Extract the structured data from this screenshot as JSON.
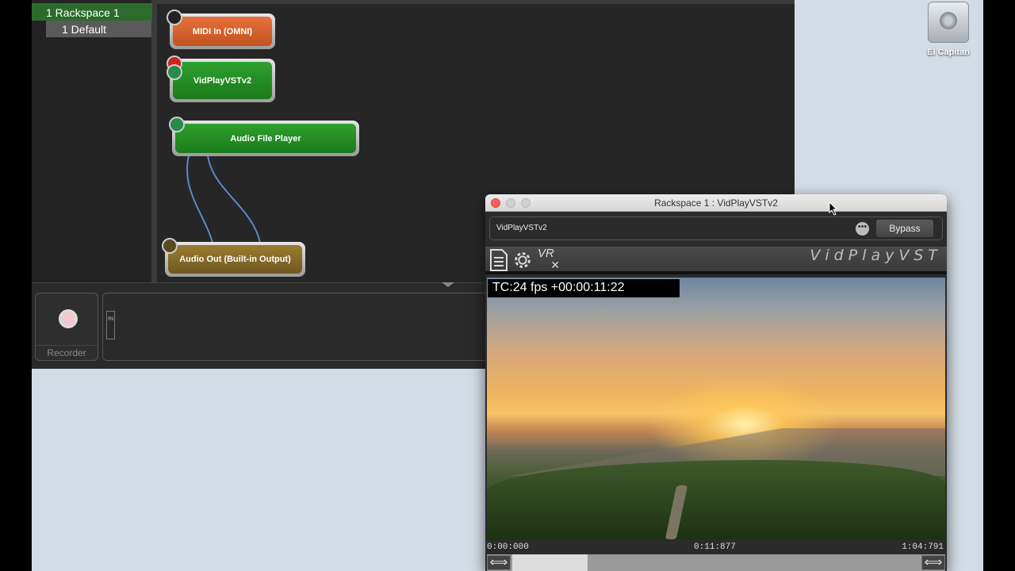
{
  "desktop": {
    "drive_label": "El Capitan"
  },
  "gig": {
    "rackspace_label": "1 Rackspace 1",
    "variation_label": "1   Default",
    "plugins": {
      "midi": "MIDI In (OMNI)",
      "vid": "VidPlayVSTv2",
      "afp": "Audio File Player",
      "out": "Audio Out (Built-in Output)"
    },
    "recorder_label": "Recorder",
    "in_tag": "IN"
  },
  "plugin_window": {
    "title": "Rackspace 1 : VidPlayVSTv2",
    "plugin_name": "VidPlayVSTv2",
    "dots": "•••",
    "bypass_label": "Bypass",
    "brand": "VidPlayVST",
    "vr_label": "VR",
    "timecode": "TC:24 fps +00:00:11:22",
    "time_start": "0:00:000",
    "time_current": "0:11:877",
    "time_end": "1:04:791",
    "arrow_left": "⟺",
    "arrow_right": "⟺"
  },
  "colors": {
    "rack_selected": "#2c6b2c",
    "midi_node": "#e7713d",
    "vst_node": "#2ea02e",
    "out_node": "#9b7c31",
    "close_button": "#fc605c"
  }
}
